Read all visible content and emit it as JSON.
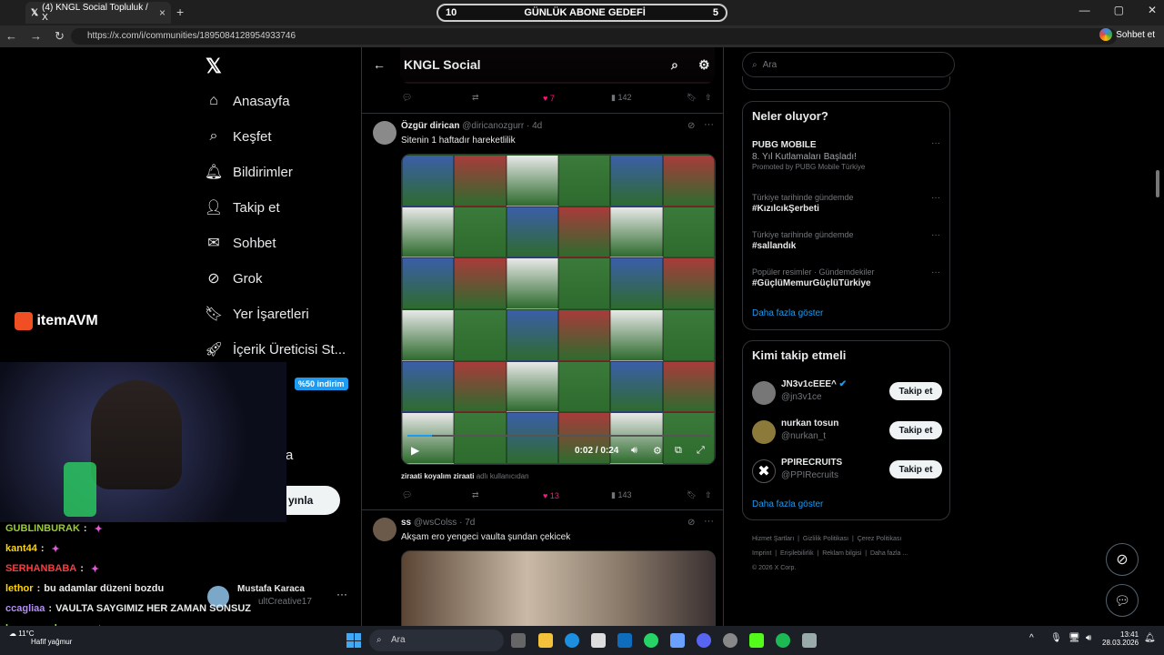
{
  "browser": {
    "tab_title": "(4) KNGL Social Topluluk / X",
    "url": "https://x.com/i/communities/1895084128954933746",
    "profile_label": "Sohbet et"
  },
  "stream_goal": {
    "left": "10",
    "label": "GÜNLÜK ABONE GEDEFİ",
    "right": "5"
  },
  "nav": {
    "items": [
      "Anasayfa",
      "Keşfet",
      "Bildirimler",
      "Takip et",
      "Sohbet",
      "Grok",
      "Yer İşaretleri",
      "İçerik Üreticisi St..."
    ],
    "notif_badge": "4",
    "dm_badge": "1",
    "discount_badge": "%50 indirim",
    "partial_letter": "a",
    "post_button_partial": "yınla",
    "account_name": "Mustafa Karaca",
    "account_handle": "ultCreative17"
  },
  "community": {
    "title": "KNGL Social",
    "top_stats": {
      "likes": "7",
      "views": "142"
    },
    "posts": [
      {
        "author": "Özgür dirican",
        "handle": "@diricanozgurr",
        "time": "4d",
        "text": "Sitenin 1 haftadır hareketlilik",
        "video_time": "0:02 / 0:24",
        "caption_user": "ziraati koyalım ziraati",
        "caption_suffix": "adlı kullanıcıdan",
        "likes": "13",
        "views": "143"
      },
      {
        "author": "ss",
        "handle": "@wsColss",
        "time": "7d",
        "text": "Akşam ero yengeci vaulta şundan çekicek"
      }
    ]
  },
  "right": {
    "search_placeholder": "Ara",
    "trends_title": "Neler oluyor?",
    "trends": [
      {
        "meta": "PUBG MOBILE",
        "name": "8. Yıl Kutlamaları Başladı!",
        "extra": "Promoted by PUBG Mobile Türkiye"
      },
      {
        "meta": "Türkiye tarihinde gündemde",
        "name": "#KızılcıkŞerbeti"
      },
      {
        "meta": "Türkiye tarihinde gündemde",
        "name": "#sallandık"
      },
      {
        "meta": "Popüler resimler · Gündemdekiler",
        "name": "#GüçlüMemurGüçlüTürkiye"
      }
    ],
    "show_more": "Daha fazla göster",
    "who_to_follow_title": "Kimi takip etmeli",
    "follow": [
      {
        "name": "JN3v1cEEE^",
        "handle": "@jn3v1ce"
      },
      {
        "name": "nurkan tosun",
        "handle": "@nurkan_t"
      },
      {
        "name": "PPIRECRUITS",
        "handle": "@PPIRecruits"
      }
    ],
    "follow_label": "Takip et",
    "show_more2": "Daha fazla göster",
    "footer": [
      "Hizmet Şartları",
      "Gizlilik Politikası",
      "Çerez Politikası",
      "Imprint",
      "Erişilebilirlik",
      "Reklam bilgisi",
      "Daha fazla ...",
      "© 2026 X Corp."
    ]
  },
  "overlay": {
    "brand": "itemAVM",
    "chat": [
      {
        "user": "GUBLINBURAK",
        "msg": "",
        "color": "#9acd32"
      },
      {
        "user": "kant44",
        "msg": "",
        "color": "#ffd400"
      },
      {
        "user": "SERHANBABA",
        "msg": "",
        "color": "#ff3b3b"
      },
      {
        "user": "lethor",
        "msg": "bu adamlar düzeni bozdu",
        "color": "#ffd400"
      },
      {
        "user": "ccagliaa",
        "msg": "VAULTA SAYGIMIZ HER ZAMAN SONSUZ",
        "color": "#b38cff"
      },
      {
        "user": "berzan_cakaner",
        "msg": "",
        "color": "#7cfc00"
      }
    ]
  },
  "taskbar": {
    "search": "Ara",
    "weather_temp": "11°C",
    "weather_text": "Hafif yağmur",
    "time": "13:41",
    "date": "28.03.2026"
  }
}
